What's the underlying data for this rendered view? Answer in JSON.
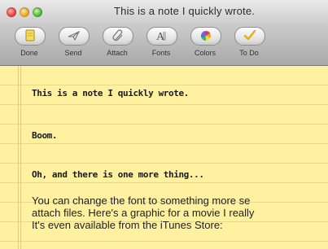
{
  "window": {
    "title": "This is a note I quickly wrote."
  },
  "toolbar": {
    "items": [
      {
        "label": "Done",
        "icon": "note-icon"
      },
      {
        "label": "Send",
        "icon": "send-icon"
      },
      {
        "label": "Attach",
        "icon": "paperclip-icon"
      },
      {
        "label": "Fonts",
        "icon": "fonts-icon"
      },
      {
        "label": "Colors",
        "icon": "color-wheel-icon"
      },
      {
        "label": "To Do",
        "icon": "checkmark-icon"
      }
    ]
  },
  "note": {
    "lines": [
      "This is a note I quickly wrote.",
      "Boom.",
      "Oh, and there is one more thing...",
      "You can change the font to something more se",
      "attach files. Here's a graphic for a movie I really",
      "It's even available from the iTunes Store:"
    ],
    "paper_color": "#fff1a0"
  }
}
